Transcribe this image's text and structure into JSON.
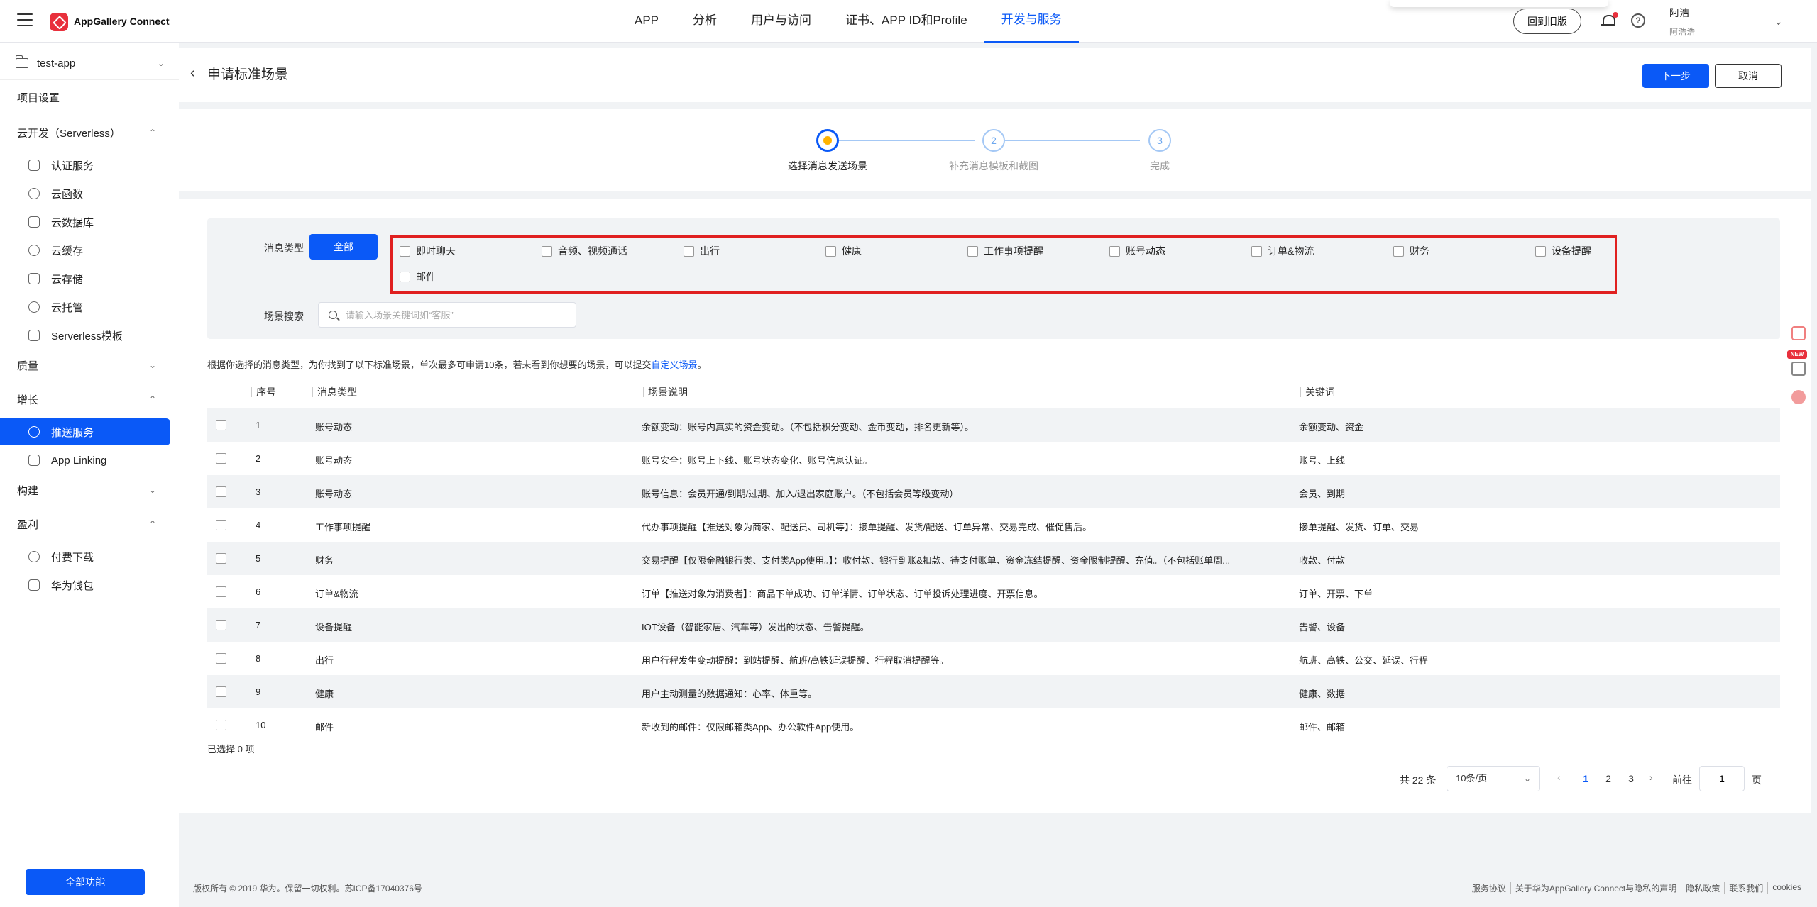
{
  "topbar": {
    "brand": "AppGallery Connect",
    "nav": [
      {
        "label": "APP",
        "active": false
      },
      {
        "label": "分析",
        "active": false
      },
      {
        "label": "用户与访问",
        "active": false
      },
      {
        "label": "证书、APP ID和Profile",
        "active": false
      },
      {
        "label": "开发与服务",
        "active": true
      }
    ],
    "old_version": "回到旧版",
    "help_glyph": "?",
    "user_name": "阿浩",
    "user_sub": "阿浩浩",
    "accent_color": "#0a59f7"
  },
  "sidebar": {
    "project": "test-app",
    "items": [
      {
        "label": "项目设置",
        "type": "group",
        "chev": ""
      },
      {
        "label": "云开发（Serverless）",
        "type": "group",
        "chev": "^"
      },
      {
        "label": "认证服务",
        "type": "sub",
        "icon": "shield-icon"
      },
      {
        "label": "云函数",
        "type": "sub",
        "icon": "cloud-function-icon"
      },
      {
        "label": "云数据库",
        "type": "sub",
        "icon": "database-icon"
      },
      {
        "label": "云缓存",
        "type": "sub",
        "icon": "cache-icon"
      },
      {
        "label": "云存储",
        "type": "sub",
        "icon": "storage-icon"
      },
      {
        "label": "云托管",
        "type": "sub",
        "icon": "hosting-icon"
      },
      {
        "label": "Serverless模板",
        "type": "sub",
        "icon": "template-icon"
      },
      {
        "label": "质量",
        "type": "group",
        "chev": "v"
      },
      {
        "label": "增长",
        "type": "group",
        "chev": "^"
      },
      {
        "label": "推送服务",
        "type": "sub",
        "icon": "push-icon",
        "active": true
      },
      {
        "label": "App Linking",
        "type": "sub",
        "icon": "link-icon"
      },
      {
        "label": "构建",
        "type": "group",
        "chev": "v"
      },
      {
        "label": "盈利",
        "type": "group",
        "chev": "^"
      },
      {
        "label": "付费下载",
        "type": "sub",
        "icon": "paid-download-icon"
      },
      {
        "label": "华为钱包",
        "type": "sub",
        "icon": "wallet-icon"
      }
    ],
    "all_functions": "全部功能"
  },
  "header": {
    "title": "申请标准场景",
    "next": "下一步",
    "cancel": "取消"
  },
  "steps": [
    {
      "num": "",
      "label": "选择消息发送场景",
      "active": true
    },
    {
      "num": "2",
      "label": "补充消息模板和截图",
      "active": false
    },
    {
      "num": "3",
      "label": "完成",
      "active": false
    }
  ],
  "filter": {
    "type_label": "消息类型",
    "all": "全部",
    "types": [
      "即时聊天",
      "音频、视频通话",
      "出行",
      "健康",
      "工作事项提醒",
      "账号动态",
      "订单&物流",
      "财务",
      "设备提醒",
      "邮件"
    ],
    "search_label": "场景搜索",
    "search_placeholder": "请输入场景关键词如“客服”"
  },
  "tip": {
    "text": "根据你选择的消息类型，为你找到了以下标准场景，单次最多可申请10条，若未看到你想要的场景，可以提交",
    "link": "自定义场景",
    "end": "。"
  },
  "table": {
    "columns": [
      "序号",
      "消息类型",
      "场景说明",
      "关键词"
    ],
    "rows": [
      {
        "no": "1",
        "type": "账号动态",
        "desc": "余额变动：账号内真实的资金变动。（不包括积分变动、金币变动，排名更新等）。",
        "kw": "余额变动、资金"
      },
      {
        "no": "2",
        "type": "账号动态",
        "desc": "账号安全：账号上下线、账号状态变化、账号信息认证。",
        "kw": "账号、上线"
      },
      {
        "no": "3",
        "type": "账号动态",
        "desc": "账号信息：会员开通/到期/过期、加入/退出家庭账户。（不包括会员等级变动）",
        "kw": "会员、到期"
      },
      {
        "no": "4",
        "type": "工作事项提醒",
        "desc": "代办事项提醒【推送对象为商家、配送员、司机等】：接单提醒、发货/配送、订单异常、交易完成、催促售后。",
        "kw": "接单提醒、发货、订单、交易"
      },
      {
        "no": "5",
        "type": "财务",
        "desc": "交易提醒【仅限金融银行类、支付类App使用。】：收付款、银行到账&扣款、待支付账单、资金冻结提醒、资金限制提醒、充值。（不包括账单周...",
        "kw": "收款、付款"
      },
      {
        "no": "6",
        "type": "订单&物流",
        "desc": "订单【推送对象为消费者】：商品下单成功、订单详情、订单状态、订单投诉处理进度、开票信息。",
        "kw": "订单、开票、下单"
      },
      {
        "no": "7",
        "type": "设备提醒",
        "desc": "IOT设备（智能家居、汽车等）发出的状态、告警提醒。",
        "kw": "告警、设备"
      },
      {
        "no": "8",
        "type": "出行",
        "desc": "用户行程发生变动提醒：到站提醒、航班/高铁延误提醒、行程取消提醒等。",
        "kw": "航班、高铁、公交、延误、行程"
      },
      {
        "no": "9",
        "type": "健康",
        "desc": "用户主动测量的数据通知：心率、体重等。",
        "kw": "健康、数据"
      },
      {
        "no": "10",
        "type": "邮件",
        "desc": "新收到的邮件：仅限邮箱类App、办公软件App使用。",
        "kw": "邮件、邮箱"
      }
    ],
    "selected": "已选择 0 项"
  },
  "pager": {
    "total": "共 22 条",
    "page_size": "10条/页",
    "prev": "‹",
    "next": "›",
    "pages": [
      "1",
      "2",
      "3"
    ],
    "current": "1",
    "goto_label": "前往",
    "goto_value": "1",
    "unit": "页"
  },
  "footer": {
    "copyright": "版权所有 © 2019 华为。保留一切权利。苏ICP备17040376号",
    "links": [
      "服务协议",
      "关于华为AppGallery Connect与隐私的声明",
      "隐私政策",
      "联系我们",
      "cookies"
    ]
  }
}
